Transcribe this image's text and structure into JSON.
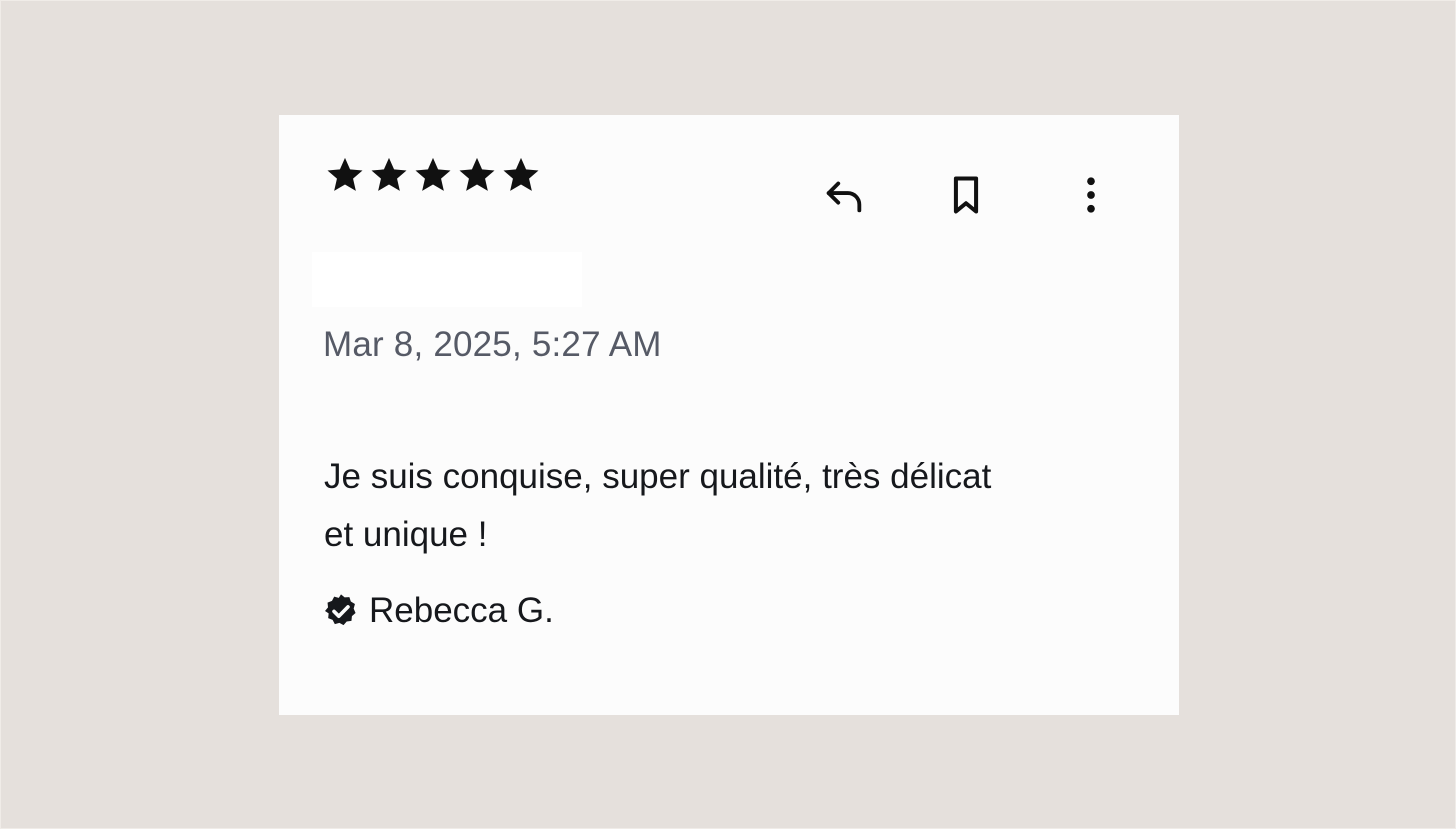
{
  "review": {
    "rating": 5,
    "rating_max": 5,
    "date": "Mar 8, 2025, 5:27 AM",
    "text": "Je suis conquise, super qualité, très délicat\net unique !",
    "author": "Rebecca G.",
    "author_badge_icon": "verified-badge-icon"
  },
  "actions": {
    "reply_icon": "reply-icon",
    "bookmark_icon": "bookmark-icon",
    "more_icon": "more-vertical-icon"
  },
  "colors": {
    "background": "#e5e0dc",
    "card": "#fcfcfc",
    "text": "#16181c",
    "date": "#565a66",
    "star": "#111111"
  }
}
